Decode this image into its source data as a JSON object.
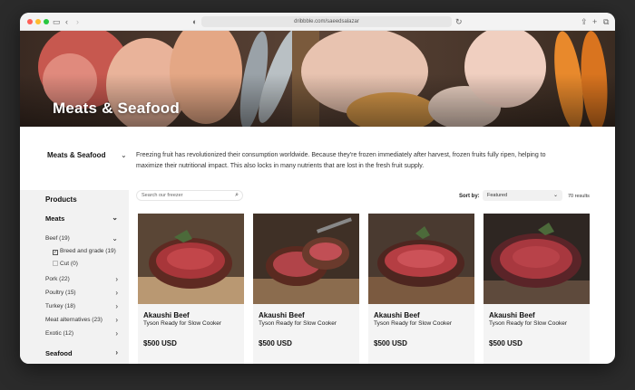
{
  "browser": {
    "url": "dribbble.com/saeedsalazar"
  },
  "hero": {
    "title": "Meats & Seafood"
  },
  "intro": {
    "category": "Meats & Seafood",
    "description": "Freezing fruit has revolutionized their consumption worldwide. Because they're frozen immediately after harvest, frozen fruits fully ripen, helping to maximize their nutritional impact. This also locks in many nutrients that are lost in the fresh fruit supply."
  },
  "sidebar": {
    "title": "Products",
    "meats_label": "Meats",
    "beef_label": "Beef (19)",
    "breed_label": "Breed and grade (19)",
    "cut_label": "Cut (0)",
    "pork_label": "Pork (22)",
    "poultry_label": "Poultry (15)",
    "turkey_label": "Turkey (18)",
    "meat_alt_label": "Meat alternatives (23)",
    "exotic_label": "Exotic (12)",
    "seafood_label": "Seafood"
  },
  "toolbar": {
    "search_placeholder": "Search our freezer",
    "sort_label": "Sort by:",
    "sort_value": "Featured",
    "results": "70 results"
  },
  "products": [
    {
      "name": "Akaushi Beef",
      "subtitle": "Tyson Ready for Slow Cooker",
      "price": "$500 USD"
    },
    {
      "name": "Akaushi Beef",
      "subtitle": "Tyson Ready for Slow Cooker",
      "price": "$500 USD"
    },
    {
      "name": "Akaushi Beef",
      "subtitle": "Tyson Ready for Slow Cooker",
      "price": "$500 USD"
    },
    {
      "name": "Akaushi Beef",
      "subtitle": "Tyson Ready for Slow Cooker",
      "price": "$500 USD"
    }
  ],
  "colors": {
    "sidebar_bg": "#f2f2f2",
    "card_bg": "#f4f4f4",
    "text": "#111111"
  }
}
